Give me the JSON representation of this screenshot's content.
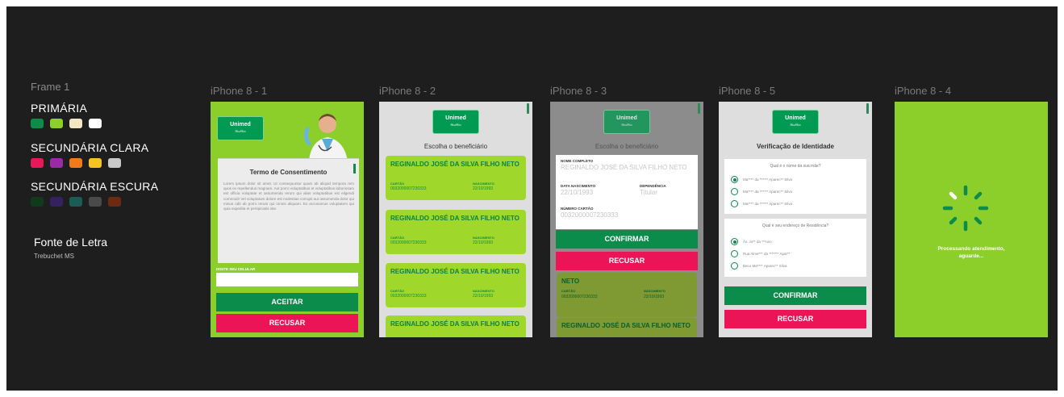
{
  "style_guide": {
    "frame_label": "Frame 1",
    "primary_label": "PRIMÁRIA",
    "secondary_light_label": "SECUNDÁRIA CLARA",
    "secondary_dark_label": "SECUNDÁRIA ESCURA",
    "font_label": "Fonte de Letra",
    "font_name": "Trebuchet MS",
    "colors": {
      "primary": [
        "#0b8c4a",
        "#8ccf2b",
        "#f3e7c6",
        "#ffffff"
      ],
      "secondary_light": [
        "#e6195b",
        "#9b2aa7",
        "#f07b1d",
        "#f7c322",
        "#c9c9c9"
      ],
      "secondary_dark": [
        "#113a1a",
        "#35215e",
        "#1d5c54",
        "#4a4a4a",
        "#6a2b12"
      ]
    }
  },
  "frames": {
    "p1": "iPhone 8 - 1",
    "p2": "iPhone 8 - 2",
    "p3": "iPhone 8 - 3",
    "p5": "iPhone 8 - 5",
    "p4": "iPhone 8 - 4"
  },
  "brand": {
    "logo": "Unimed",
    "logo_sub": "Rio/Rio"
  },
  "consent": {
    "title": "Termo de Consentimento",
    "text": "Lorem ipsum dolor sit amet. Ut consequuntur quam ab aliquid tempora rem quos ex repellendus magnam. Aut porro voluptatibus et voluptatibus laboriosam est officia voluptate et assumenda rerum qui alias voluptatibus est eligendi commodi! Vel voluptatum dolore est molestiae corrupti aut assumenda dolor qui minus odit ab porro rerum qui omnis aliquam. Ex accusamus voluptatem qui quia expedita et perspiciatis iste.",
    "phone_label": "DIGITE SEU CELULAR",
    "accept": "ACEITAR",
    "refuse": "RECUSAR"
  },
  "choose": {
    "subtitle": "Escolha o beneficiário",
    "name": "REGINALDO JOSÉ DA SILVA FILHO NETO",
    "card_label": "CARTÃO",
    "birth_label": "NASCIMENTO",
    "card_value": "0032000007230333",
    "birth_value": "22/10/1993"
  },
  "confirm": {
    "subtitle": "Escolha o beneficiário",
    "full_name_label": "NOME COMPLETO",
    "full_name": "REGINALDO JOSÉ DA SILVA FILHO NETO",
    "birth_label": "DATA NASCIMENTO",
    "birth_value": "22/10/1993",
    "dependency_label": "DEPENDÊNCIA",
    "dependency_value": "Titular",
    "card_number_label": "NÚMERO CARTÃO",
    "card_number": "0032000007230333",
    "confirm": "CONFIRMAR",
    "refuse": "RECUSAR",
    "bg_name_tail": "NETO",
    "bg_name": "REGINALDO JOSÉ DA SILVA FILHO NETO"
  },
  "verify": {
    "title": "Verificação de Identidade",
    "q1": "Qual é o nome da sua mãe?",
    "q1_options": [
      "Ma**** da ****** Aparec** Silva",
      "Ma**** da ****** Aparec** Silva",
      "Ma**** da ****** Aparec** Silva"
    ],
    "q2": "Qual é seu endereço de Residência?",
    "q2_options": [
      "Av. Jo** da ***oso",
      "Rua Alme*** da ******* Apar**",
      "Beco Ma**** Aparec** Silva"
    ],
    "confirm": "CONFIRMAR",
    "refuse": "RECUSAR"
  },
  "processing": {
    "text_line1": "Processando atendimento,",
    "text_line2": "aguarde..."
  }
}
